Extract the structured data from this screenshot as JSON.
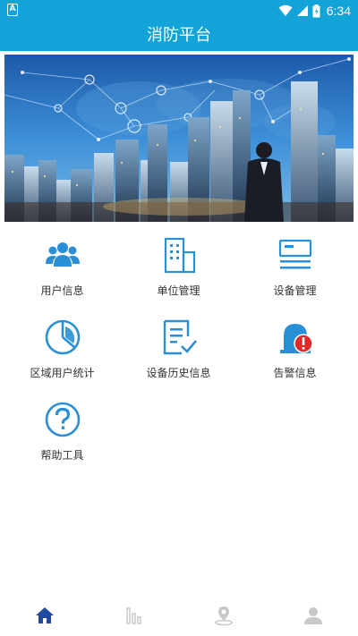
{
  "status_bar": {
    "time": "6:34",
    "notification_icon": "a-icon",
    "icons": [
      "wifi-icon",
      "signal-icon",
      "battery-icon"
    ]
  },
  "header": {
    "title": "消防平台"
  },
  "banner": {
    "image": "city-skyline-businessman-network-banner"
  },
  "menu": [
    {
      "label": "用户信息",
      "icon": "users-icon"
    },
    {
      "label": "单位管理",
      "icon": "building-icon"
    },
    {
      "label": "设备管理",
      "icon": "device-icon"
    },
    {
      "label": "区域用户统计",
      "icon": "pie-chart-icon"
    },
    {
      "label": "设备历史信息",
      "icon": "history-document-icon"
    },
    {
      "label": "告警信息",
      "icon": "alarm-icon"
    },
    {
      "label": "帮助工具",
      "icon": "help-icon"
    }
  ],
  "tab_bar": {
    "tabs": [
      {
        "icon": "home-icon",
        "active": true
      },
      {
        "icon": "statistics-icon",
        "active": false
      },
      {
        "icon": "location-icon",
        "active": false
      },
      {
        "icon": "profile-icon",
        "active": false
      }
    ]
  },
  "colors": {
    "header_bg": "#12a4d8",
    "icon_blue": "#2a8fd6",
    "alert_red": "#e02a2a",
    "tab_active": "#1f4aa0",
    "tab_inactive": "#c8c8c8"
  }
}
